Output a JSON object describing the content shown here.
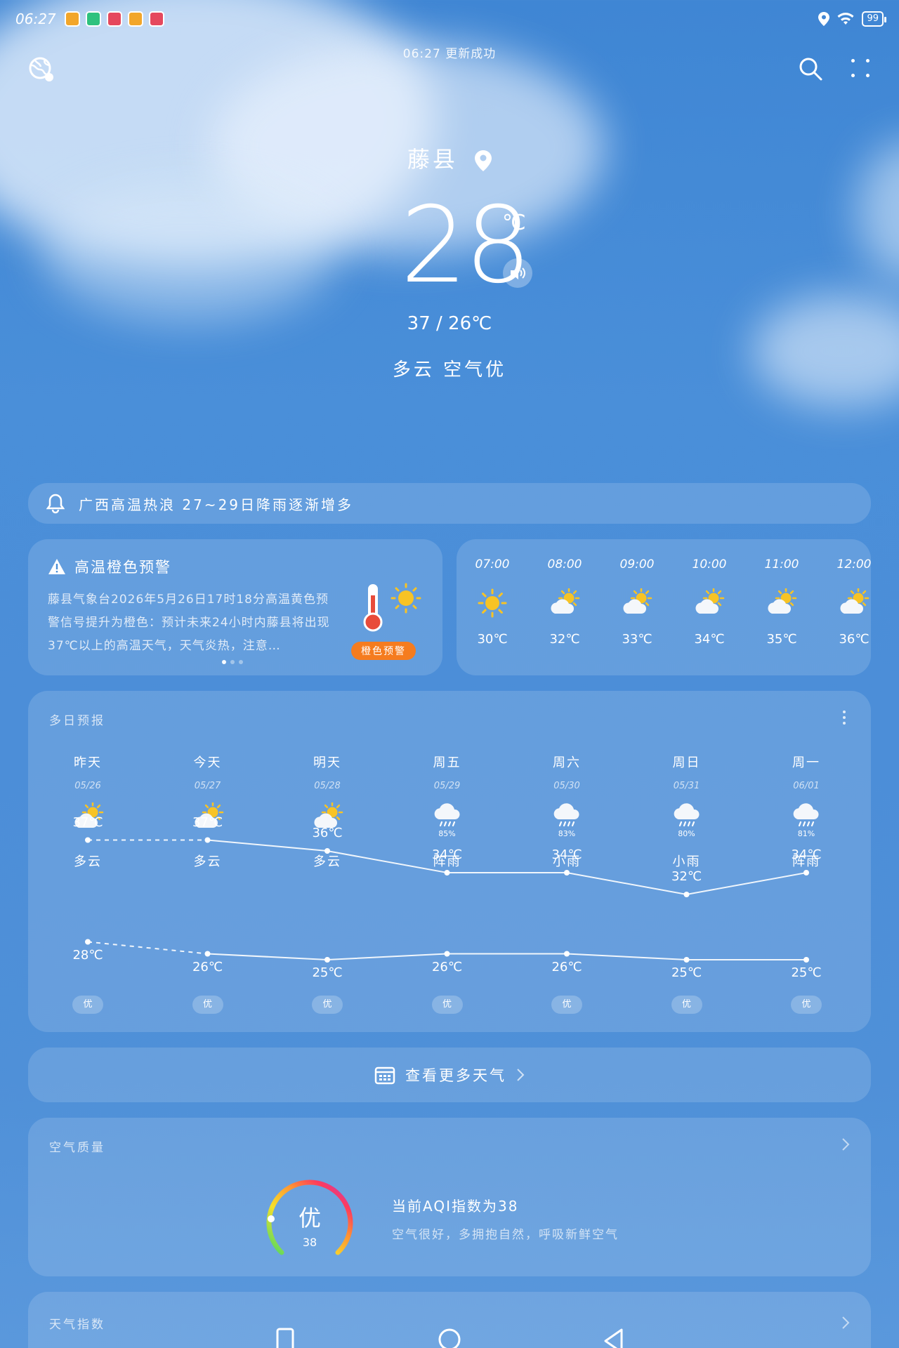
{
  "status_bar": {
    "time": "06:27",
    "battery": "99"
  },
  "header": {
    "update_text": "06:27 更新成功",
    "city": "藤县"
  },
  "current": {
    "temperature": "28",
    "unit": "℃",
    "range": "37 / 26℃",
    "condition": "多云 空气优"
  },
  "news_alert": {
    "text": "广西高温热浪 27~29日降雨逐渐增多"
  },
  "warning": {
    "title": "高温橙色预警",
    "text": "藤县气象台2026年5月26日17时18分高温黄色预警信号提升为橙色：预计未来24小时内藤县将出现37℃以上的高温天气，天气炎热，注意…",
    "badge": "橙色预警",
    "page_index": 1,
    "page_count": 3
  },
  "hourly": [
    {
      "time": "07:00",
      "icon": "sun-icon",
      "temp": "30℃"
    },
    {
      "time": "08:00",
      "icon": "partly-cloudy-icon",
      "temp": "32℃"
    },
    {
      "time": "09:00",
      "icon": "partly-cloudy-icon",
      "temp": "33℃"
    },
    {
      "time": "10:00",
      "icon": "partly-cloudy-icon",
      "temp": "34℃"
    },
    {
      "time": "11:00",
      "icon": "partly-cloudy-icon",
      "temp": "35℃"
    },
    {
      "time": "12:00",
      "icon": "partly-cloudy-icon",
      "temp": "36℃"
    }
  ],
  "forecast": {
    "title": "多日预报",
    "days": [
      {
        "name": "昨天",
        "date": "05/26",
        "icon": "partly-cloudy-icon",
        "pop": "",
        "cond": "多云",
        "high": "37℃",
        "low": "28℃",
        "aqi": "优"
      },
      {
        "name": "今天",
        "date": "05/27",
        "icon": "partly-cloudy-icon",
        "pop": "",
        "cond": "多云",
        "high": "37℃",
        "low": "26℃",
        "aqi": "优"
      },
      {
        "name": "明天",
        "date": "05/28",
        "icon": "partly-cloudy-icon",
        "pop": "",
        "cond": "多云",
        "high": "36℃",
        "low": "25℃",
        "aqi": "优"
      },
      {
        "name": "周五",
        "date": "05/29",
        "icon": "rain-icon",
        "pop": "85%",
        "cond": "阵雨",
        "high": "34℃",
        "low": "26℃",
        "aqi": "优"
      },
      {
        "name": "周六",
        "date": "05/30",
        "icon": "rain-icon",
        "pop": "83%",
        "cond": "小雨",
        "high": "34℃",
        "low": "26℃",
        "aqi": "优"
      },
      {
        "name": "周日",
        "date": "05/31",
        "icon": "rain-icon",
        "pop": "80%",
        "cond": "小雨",
        "high": "32℃",
        "low": "25℃",
        "aqi": "优"
      },
      {
        "name": "周一",
        "date": "06/01",
        "icon": "rain-icon",
        "pop": "81%",
        "cond": "阵雨",
        "high": "34℃",
        "low": "25℃",
        "aqi": "优"
      }
    ],
    "high_values": [
      37,
      37,
      36,
      34,
      34,
      32,
      34
    ],
    "low_values": [
      28,
      26,
      25,
      26,
      26,
      25,
      25
    ]
  },
  "more_weather": {
    "label": "查看更多天气"
  },
  "air_quality": {
    "title": "空气质量",
    "level": "优",
    "value": "38",
    "headline": "当前AQI指数为38",
    "description": "空气很好，多拥抱自然，呼吸新鲜空气"
  },
  "index_section": {
    "title": "天气指数"
  },
  "colors": {
    "warning_badge": "#f57c1f",
    "sun": "#f7c325",
    "thermometer": "#e84b3a"
  }
}
